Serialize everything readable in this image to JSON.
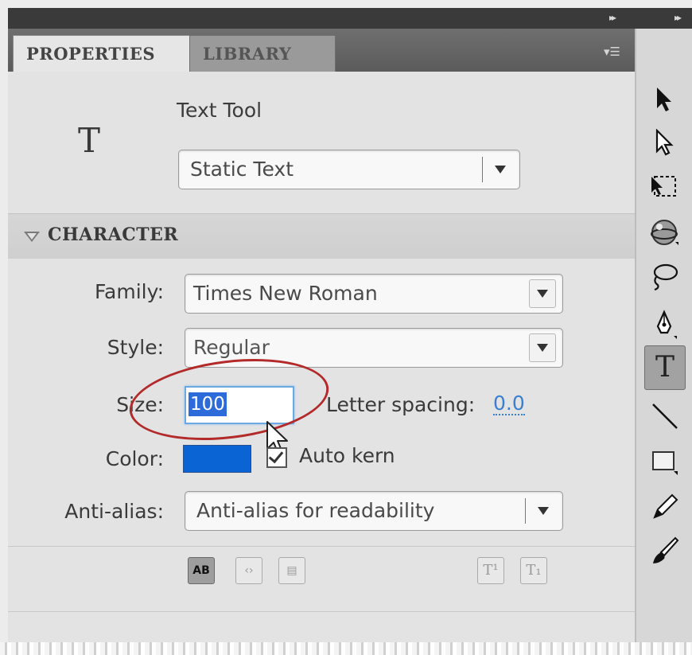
{
  "tabs": {
    "properties": "PROPERTIES",
    "library": "LIBRARY"
  },
  "tool": {
    "glyph": "T",
    "name": "Text Tool",
    "text_type": "Static Text"
  },
  "character": {
    "section_title": "CHARACTER",
    "family_label": "Family:",
    "family_value": "Times New Roman",
    "style_label": "Style:",
    "style_value": "Regular",
    "size_label": "Size:",
    "size_value": "100",
    "letter_spacing_label": "Letter spacing:",
    "letter_spacing_value": "0.0",
    "color_label": "Color:",
    "color_value": "#0a64d4",
    "auto_kern_label": "Auto kern",
    "auto_kern_checked": true,
    "anti_alias_label": "Anti-alias:",
    "anti_alias_value": "Anti-alias for readability"
  },
  "format_buttons": {
    "selectable": "AB"
  },
  "toolbar": [
    "selection-tool",
    "subselection-tool",
    "free-transform-tool",
    "3d-rotation-tool",
    "lasso-tool",
    "pen-tool",
    "text-tool",
    "line-tool",
    "rectangle-tool",
    "pencil-tool",
    "brush-tool"
  ],
  "colors": {
    "accent": "#2d6bd8",
    "annotation": "#b22a2a"
  }
}
